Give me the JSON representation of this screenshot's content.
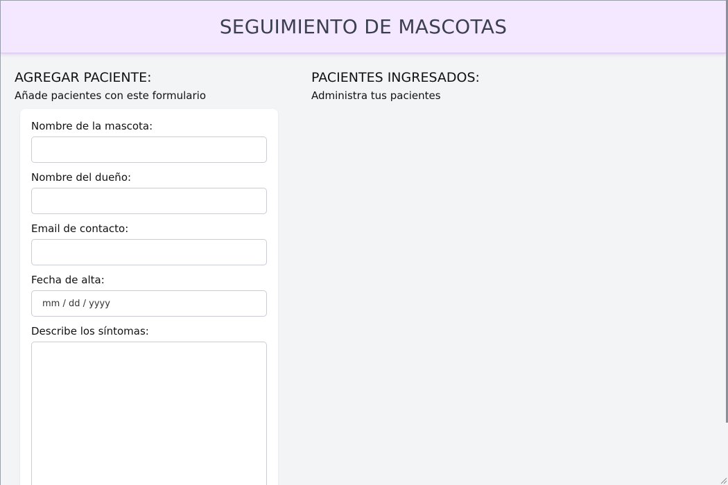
{
  "header": {
    "title": "SEGUIMIENTO DE MASCOTAS"
  },
  "add_section": {
    "title": "AGREGAR PACIENTE:",
    "subtitle": "Añade pacientes con este formulario"
  },
  "list_section": {
    "title": "PACIENTES INGRESADOS:",
    "subtitle": "Administra tus pacientes"
  },
  "form": {
    "pet_name": {
      "label": "Nombre de la mascota:",
      "value": "",
      "placeholder": ""
    },
    "owner_name": {
      "label": "Nombre del dueño:",
      "value": "",
      "placeholder": ""
    },
    "email": {
      "label": "Email de contacto:",
      "value": "",
      "placeholder": ""
    },
    "discharge_date": {
      "label": "Fecha de alta:",
      "placeholder": "mm / dd / yyyy"
    },
    "symptoms": {
      "label": "Describe los síntomas:",
      "value": ""
    }
  },
  "colors": {
    "header_bg": "#f3e8ff",
    "page_bg": "#f3f4f6",
    "card_bg": "#ffffff"
  }
}
